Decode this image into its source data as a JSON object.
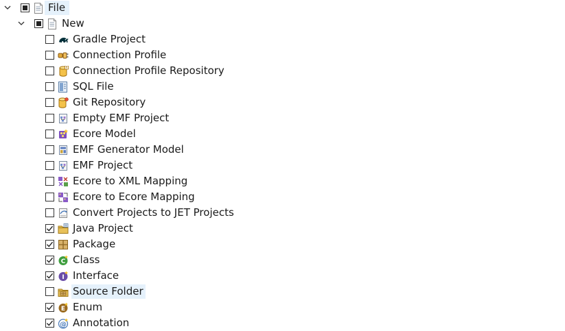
{
  "tree": {
    "root": {
      "label": "File",
      "checkbox": "partial",
      "expanded": true,
      "icon": "page-icon"
    },
    "new_node": {
      "label": "New",
      "checkbox": "partial",
      "expanded": true,
      "icon": "page-icon"
    },
    "items": [
      {
        "label": "Gradle Project",
        "checked": false,
        "icon": "gradle-elephant-icon"
      },
      {
        "label": "Connection Profile",
        "checked": false,
        "icon": "connection-plug-icon"
      },
      {
        "label": "Connection Profile Repository",
        "checked": false,
        "icon": "repository-cylinder-icon"
      },
      {
        "label": "SQL File",
        "checked": false,
        "icon": "sql-file-icon"
      },
      {
        "label": "Git Repository",
        "checked": false,
        "icon": "git-repository-icon"
      },
      {
        "label": "Empty EMF Project",
        "checked": false,
        "icon": "emf-project-icon"
      },
      {
        "label": "Ecore Model",
        "checked": false,
        "icon": "ecore-model-icon"
      },
      {
        "label": "EMF Generator Model",
        "checked": false,
        "icon": "generator-model-icon"
      },
      {
        "label": "EMF Project",
        "checked": false,
        "icon": "emf-project-icon"
      },
      {
        "label": "Ecore to XML Mapping",
        "checked": false,
        "icon": "xml-mapping-icon"
      },
      {
        "label": "Ecore to Ecore Mapping",
        "checked": false,
        "icon": "ecore-mapping-icon"
      },
      {
        "label": "Convert Projects to JET Projects",
        "checked": false,
        "icon": "jet-convert-icon"
      },
      {
        "label": "Java Project",
        "checked": true,
        "icon": "java-project-folder-icon"
      },
      {
        "label": "Package",
        "checked": true,
        "icon": "package-icon"
      },
      {
        "label": "Class",
        "checked": true,
        "icon": "class-icon"
      },
      {
        "label": "Interface",
        "checked": true,
        "icon": "interface-icon"
      },
      {
        "label": "Source Folder",
        "checked": false,
        "icon": "source-folder-icon",
        "highlighted": true
      },
      {
        "label": "Enum",
        "checked": true,
        "icon": "enum-icon"
      },
      {
        "label": "Annotation",
        "checked": true,
        "icon": "annotation-icon"
      }
    ]
  },
  "colors": {
    "selection_bg": "#e5f1fb",
    "class_green": "#3e9e3e",
    "interface_purple": "#6b4ea8",
    "enum_brown": "#9a6a1e",
    "package_tan": "#c9a15a",
    "folder_yellow": "#e8c15a"
  }
}
